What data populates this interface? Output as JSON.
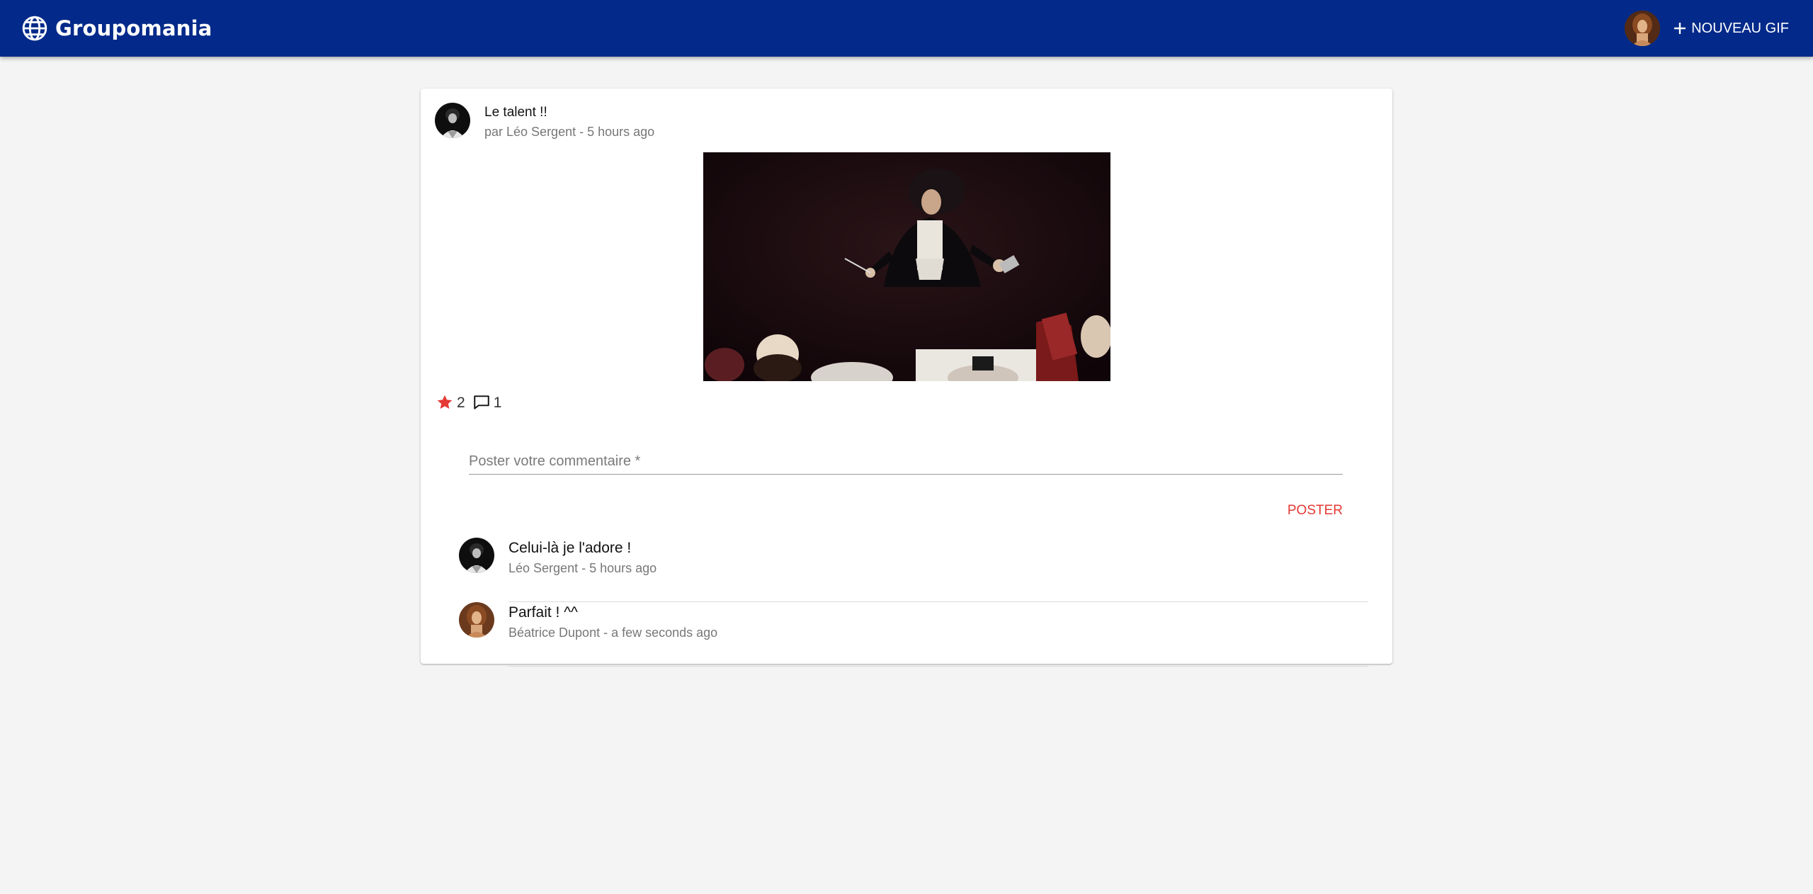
{
  "app": {
    "brand_name": "Groupomania",
    "brand_icon": "globe-icon",
    "colors": {
      "appbar": "#032a8a",
      "accent": "#e53935",
      "background": "#f4f4f4"
    }
  },
  "header": {
    "new_gif_label": "NOUVEAU GIF",
    "new_gif_icon": "plus-icon",
    "user_avatar": "avatar-beatrice"
  },
  "post": {
    "title": "Le talent !!",
    "meta": "par Léo Sergent - 5 hours ago",
    "author_avatar": "avatar-leo",
    "media": "gif-orchestra-conductor",
    "likes_count": "2",
    "likes_icon": "star-icon",
    "comments_count": "1",
    "comments_icon": "comment-icon"
  },
  "comment_form": {
    "placeholder": "Poster votre commentaire *",
    "value": "",
    "submit_label": "POSTER"
  },
  "comments": [
    {
      "text": "Celui-là je l'adore !",
      "meta": "Léo Sergent - 5 hours ago",
      "avatar": "avatar-leo"
    },
    {
      "text": "Parfait ! ^^",
      "meta": "Béatrice Dupont - a few seconds ago",
      "avatar": "avatar-beatrice"
    }
  ]
}
